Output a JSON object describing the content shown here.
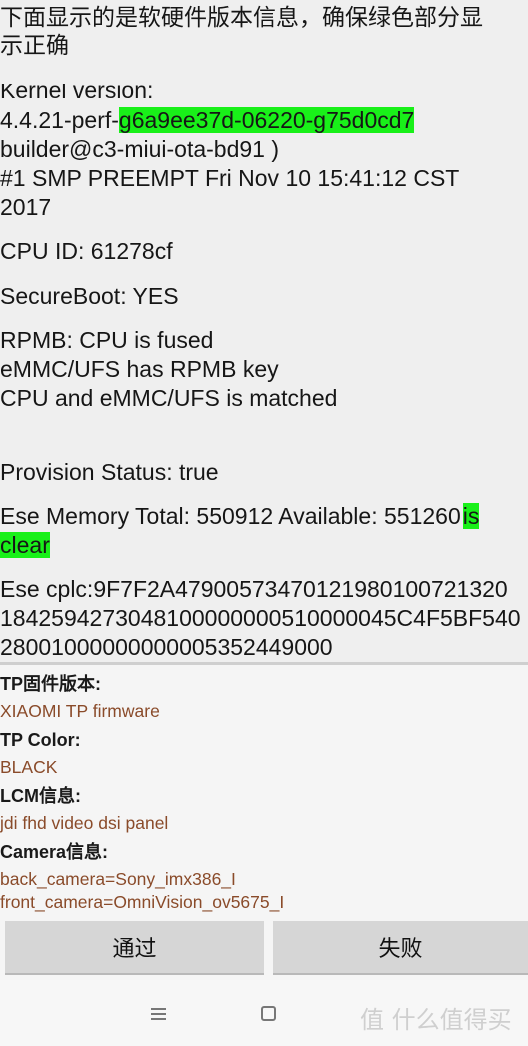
{
  "header": {
    "line1": "下面显示的是软硬件版本信息，确保绿色部分显",
    "line2": "示正确"
  },
  "kernel": {
    "label": "Kernel version:",
    "prefix": "4.4.21-perf-",
    "highlight": "g6a9ee37d-06220-g75d0cd7",
    "builder": "builder@c3-miui-ota-bd91 )",
    "build_line": "#1 SMP PREEMPT Fri Nov 10 15:41:12 CST",
    "year": "2017"
  },
  "cpu_id": "CPU ID: 61278cf",
  "secure_boot": "SecureBoot: YES",
  "rpmb": [
    "RPMB: CPU is fused",
    "eMMC/UFS has RPMB key",
    "CPU and eMMC/UFS is matched"
  ],
  "provision": "Provision Status: true",
  "ese_memory": {
    "text": "Ese Memory Total: 550912 Available: 551260",
    "hl1": "is",
    "hl2": "clear"
  },
  "ese_cplc": [
    "Ese cplc:9F7F2A47900573470121980100721320",
    "1842594273048100000000510000045C4F5BF540",
    "28001000000000005352449000"
  ],
  "info": [
    {
      "label": "TP固件版本:",
      "values": [
        "XIAOMI TP firmware"
      ]
    },
    {
      "label": "TP Color:",
      "values": [
        "BLACK"
      ]
    },
    {
      "label": "LCM信息:",
      "values": [
        "jdi fhd video dsi panel"
      ]
    },
    {
      "label": "Camera信息:",
      "values": [
        "back_camera=Sony_imx386_I",
        "front_camera=OmniVision_ov5675_I"
      ]
    }
  ],
  "buttons": {
    "pass": "通过",
    "fail": "失败"
  },
  "nav": {
    "menu_icon": "menu-icon",
    "home_icon": "home-square-icon"
  },
  "watermark": "值 什么值得买",
  "colors": {
    "highlight": "#19f019",
    "value_text": "#8a4b2a"
  }
}
